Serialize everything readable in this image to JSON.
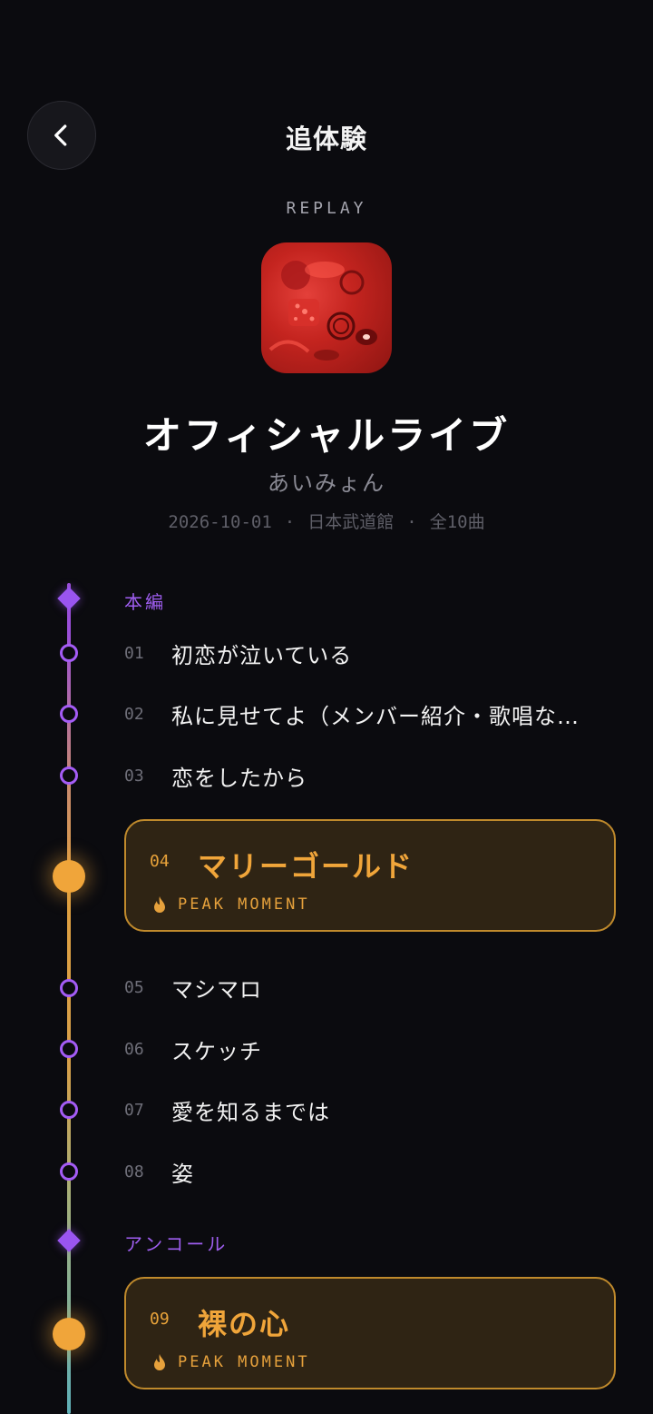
{
  "header": {
    "title": "追体験",
    "back_icon": "chevron-left-icon"
  },
  "hero": {
    "eyebrow": "REPLAY",
    "album_title": "オフィシャルライブ",
    "artist": "あいみょん",
    "date": "2026-10-01",
    "venue": "日本武道館",
    "track_count": "全10曲",
    "separator": "·"
  },
  "sections": {
    "main": {
      "label": "本編"
    },
    "encore": {
      "label": "アンコール"
    }
  },
  "tracks": [
    {
      "num": "01",
      "name": "初恋が泣いている"
    },
    {
      "num": "02",
      "name": "私に見せてよ（メンバー紹介・歌唱な…"
    },
    {
      "num": "03",
      "name": "恋をしたから"
    },
    {
      "num": "04",
      "name": "マリーゴールド",
      "badge": "PEAK MOMENT"
    },
    {
      "num": "05",
      "name": "マシマロ"
    },
    {
      "num": "06",
      "name": "スケッチ"
    },
    {
      "num": "07",
      "name": "愛を知るまでは"
    },
    {
      "num": "08",
      "name": "姿"
    },
    {
      "num": "09",
      "name": "裸の心",
      "badge": "PEAK MOMENT"
    }
  ],
  "colors": {
    "accent_purple": "#9a55f0",
    "peak_orange": "#f0a53a",
    "background": "#0b0b0f"
  }
}
